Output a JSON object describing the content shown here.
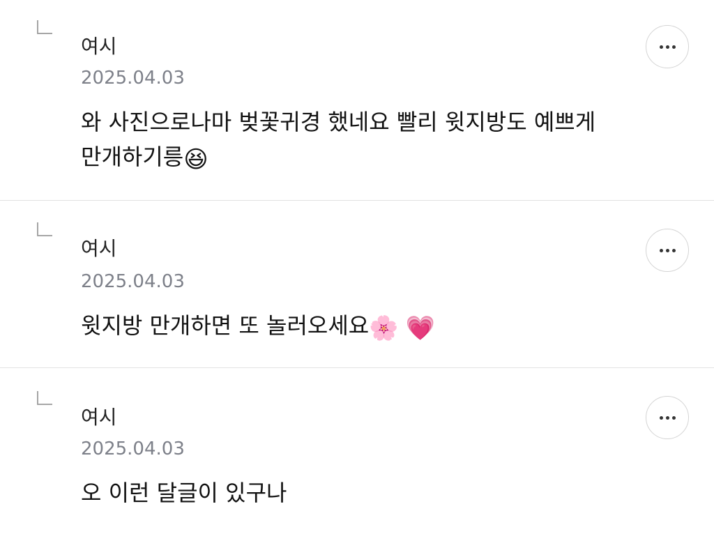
{
  "comments": [
    {
      "author": "여시",
      "date": "2025.04.03",
      "text_line1": "와 사진으로나마 벚꽃귀경 했네요 빨리 윗지방도 예쁘게",
      "text_line2": "만개하기릉",
      "emoji": "😆"
    },
    {
      "author": "여시",
      "date": "2025.04.03",
      "text": "윗지방 만개하면 또 놀러오세요",
      "emoji1": "🌸",
      "emoji2": "💗"
    },
    {
      "author": "여시",
      "date": "2025.04.03",
      "text": "오 이런 달글이 있구나"
    }
  ],
  "icons": {
    "reply_indicator": "reply-arrow-icon",
    "more_options": "more-dots-icon"
  },
  "colors": {
    "date_text": "#7d8089",
    "divider": "#e2e2e2",
    "button_border": "#d4d4d4"
  }
}
